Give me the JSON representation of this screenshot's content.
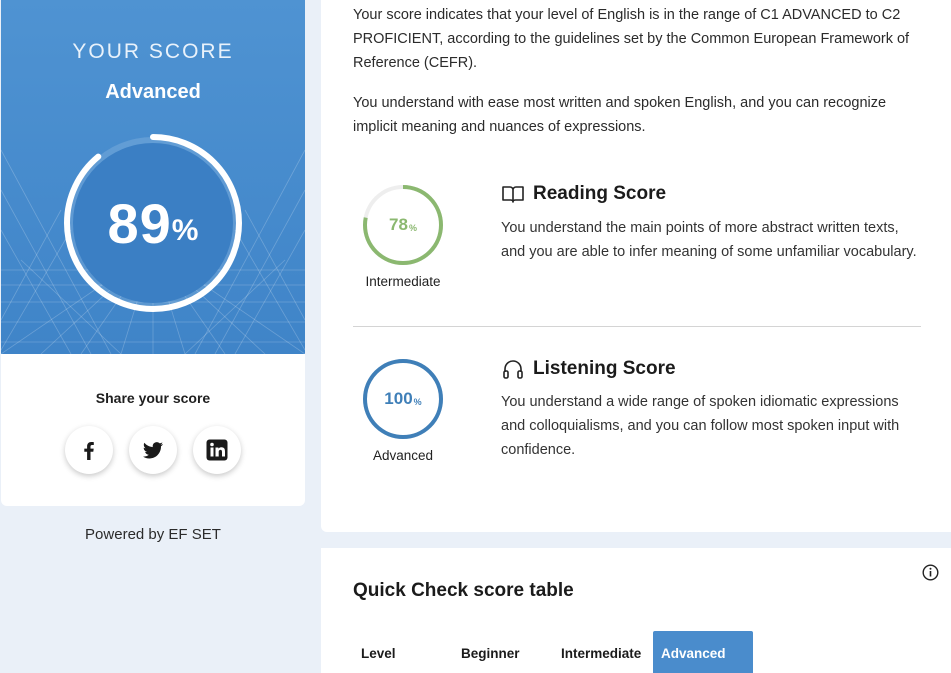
{
  "score_card": {
    "label": "YOUR SCORE",
    "level": "Advanced",
    "value": "89",
    "unit": "%",
    "fraction": 0.89,
    "share_title": "Share your score",
    "share_icons": [
      "facebook-icon",
      "twitter-icon",
      "linkedin-icon"
    ],
    "powered_by": "Powered by EF SET"
  },
  "intro": {
    "paragraph1": "Your score indicates that your level of English is in the range of C1 ADVANCED to C2 PROFICIENT, according to the guidelines set by the Common European Framework of Reference (CEFR).",
    "paragraph2": "You understand with ease most written and spoken English, and you can recognize implicit meaning and nuances of expressions."
  },
  "reading": {
    "title": "Reading Score",
    "icon": "book-icon",
    "value": "78",
    "unit": "%",
    "fraction": 0.78,
    "level": "Intermediate",
    "color": "#8bb870",
    "description": "You understand the main points of more abstract written texts, and you are able to infer meaning of some unfamiliar vocabulary."
  },
  "listening": {
    "title": "Listening Score",
    "icon": "headphones-icon",
    "value": "100",
    "unit": "%",
    "fraction": 1.0,
    "level": "Advanced",
    "color": "#3f7fb8",
    "description": "You understand a wide range of spoken idiomatic expressions and colloquialisms, and you can follow most spoken input with confidence."
  },
  "score_table": {
    "title": "Quick Check score table",
    "columns": [
      "Level",
      "Beginner",
      "Intermediate",
      "Advanced"
    ],
    "active_column": "Advanced"
  },
  "colors": {
    "accent": "#4a8ccc",
    "hero": "#4f93d2",
    "page_bg": "#eaf0f8"
  }
}
